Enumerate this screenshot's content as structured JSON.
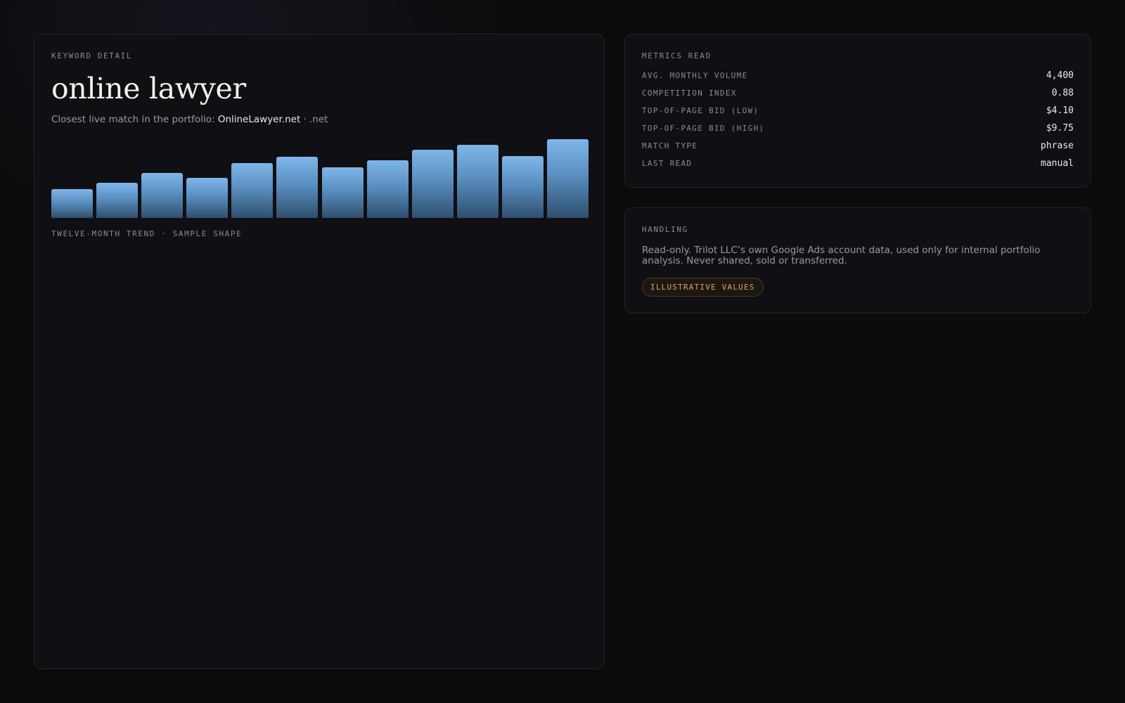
{
  "keyword_card": {
    "eyebrow": "KEYWORD DETAIL",
    "keyword": "online lawyer",
    "match_prefix": "Closest live match in the portfolio:",
    "match_domain": "OnlineLawyer.net",
    "match_separator": "·",
    "match_tld": ".net",
    "trend_caption": "TWELVE-MONTH TREND · SAMPLE SHAPE"
  },
  "chart_data": {
    "type": "bar",
    "values": [
      0.37,
      0.45,
      0.57,
      0.51,
      0.7,
      0.78,
      0.64,
      0.73,
      0.87,
      0.93,
      0.79,
      1.0
    ],
    "bar_color": "#6fa6d8"
  },
  "metrics": {
    "heading": "METRICS READ",
    "rows": [
      {
        "label": "AVG. MONTHLY VOLUME",
        "value": "4,400"
      },
      {
        "label": "COMPETITION INDEX",
        "value": "0.88"
      },
      {
        "label": "TOP-OF-PAGE BID (LOW)",
        "value": "$4.10"
      },
      {
        "label": "TOP-OF-PAGE BID (HIGH)",
        "value": "$9.75"
      },
      {
        "label": "MATCH TYPE",
        "value": "phrase"
      },
      {
        "label": "LAST READ",
        "value": "manual"
      }
    ]
  },
  "handling": {
    "heading": "HANDLING",
    "text": "Read-only. Trilot LLC’s own Google Ads account data, used only for internal portfolio analysis. Never shared, sold or transferred.",
    "badge": "ILLUSTRATIVE VALUES",
    "badge_color": "#e2a357"
  }
}
